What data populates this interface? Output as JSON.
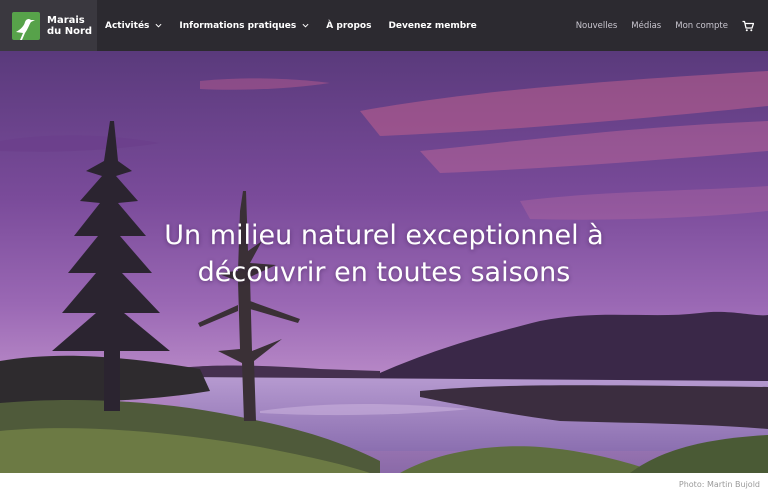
{
  "brand": {
    "line1": "Marais",
    "line2": "du Nord"
  },
  "nav": {
    "items": [
      {
        "label": "Activités",
        "has_dropdown": true
      },
      {
        "label": "Informations pratiques",
        "has_dropdown": true
      },
      {
        "label": "À propos",
        "has_dropdown": false
      },
      {
        "label": "Devenez membre",
        "has_dropdown": false
      }
    ],
    "secondary": [
      {
        "label": "Nouvelles"
      },
      {
        "label": "Médias"
      },
      {
        "label": "Mon compte"
      }
    ],
    "cart_icon": "shopping-cart-icon"
  },
  "hero": {
    "headline_line1": "Un milieu naturel exceptionnel à",
    "headline_line2": "découvrir en toutes saisons"
  },
  "photo_credit": "Photo: Martin Bujold",
  "colors": {
    "nav_bg": "#2c2a30",
    "brand_bg": "#3a383f",
    "logo_green": "#57a24a",
    "sky_purple": "#7a4b9a",
    "sky_pink": "#c0608e"
  }
}
